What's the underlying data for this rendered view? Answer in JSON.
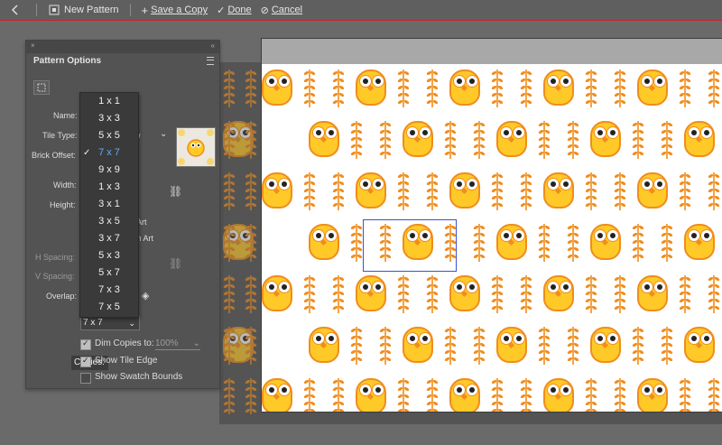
{
  "topbar": {
    "new_pattern_label": "New Pattern",
    "save_copy_label": "Save a Copy",
    "done_label": "Done",
    "cancel_label": "Cancel"
  },
  "panel": {
    "title": "Pattern Options",
    "labels": {
      "name": "Name:",
      "tile_type": "Tile Type:",
      "brick_offset": "Brick Offset:",
      "width": "Width:",
      "height": "Height:",
      "h_spacing": "H Spacing:",
      "v_spacing": "V Spacing:",
      "overlap": "Overlap:",
      "copies": "Copies:"
    },
    "tile_type_value_fragment": "w",
    "size_option_1_fragment": "Art",
    "size_option_2_fragment": "th Art",
    "copies_value": "7 x 7",
    "dim_copies_label": "Dim Copies to:",
    "dim_copies_value": "100%",
    "show_tile_edge_label": "Show Tile Edge",
    "show_swatch_bounds_label": "Show Swatch Bounds",
    "dim_copies_checked": true,
    "show_tile_edge_checked": true,
    "show_swatch_bounds_checked": false
  },
  "dropdown": {
    "items": [
      "1 x 1",
      "3 x 3",
      "5 x 5",
      "7 x 7",
      "9 x 9",
      "1 x 3",
      "3 x 1",
      "3 x 5",
      "3 x 7",
      "5 x 3",
      "5 x 7",
      "7 x 3",
      "7 x 5"
    ],
    "selected": "7 x 7"
  },
  "colors": {
    "owl_body": "#ffc928",
    "owl_outline": "#f08d1d",
    "tile_edge": "#3b4fd1",
    "selection_text": "#66a8ff"
  },
  "icons": [
    "back-arrow-icon",
    "plus-icon",
    "check-icon",
    "cancel-icon",
    "panel-menu-icon",
    "pattern-tile-tool-icon",
    "link-icon"
  ]
}
